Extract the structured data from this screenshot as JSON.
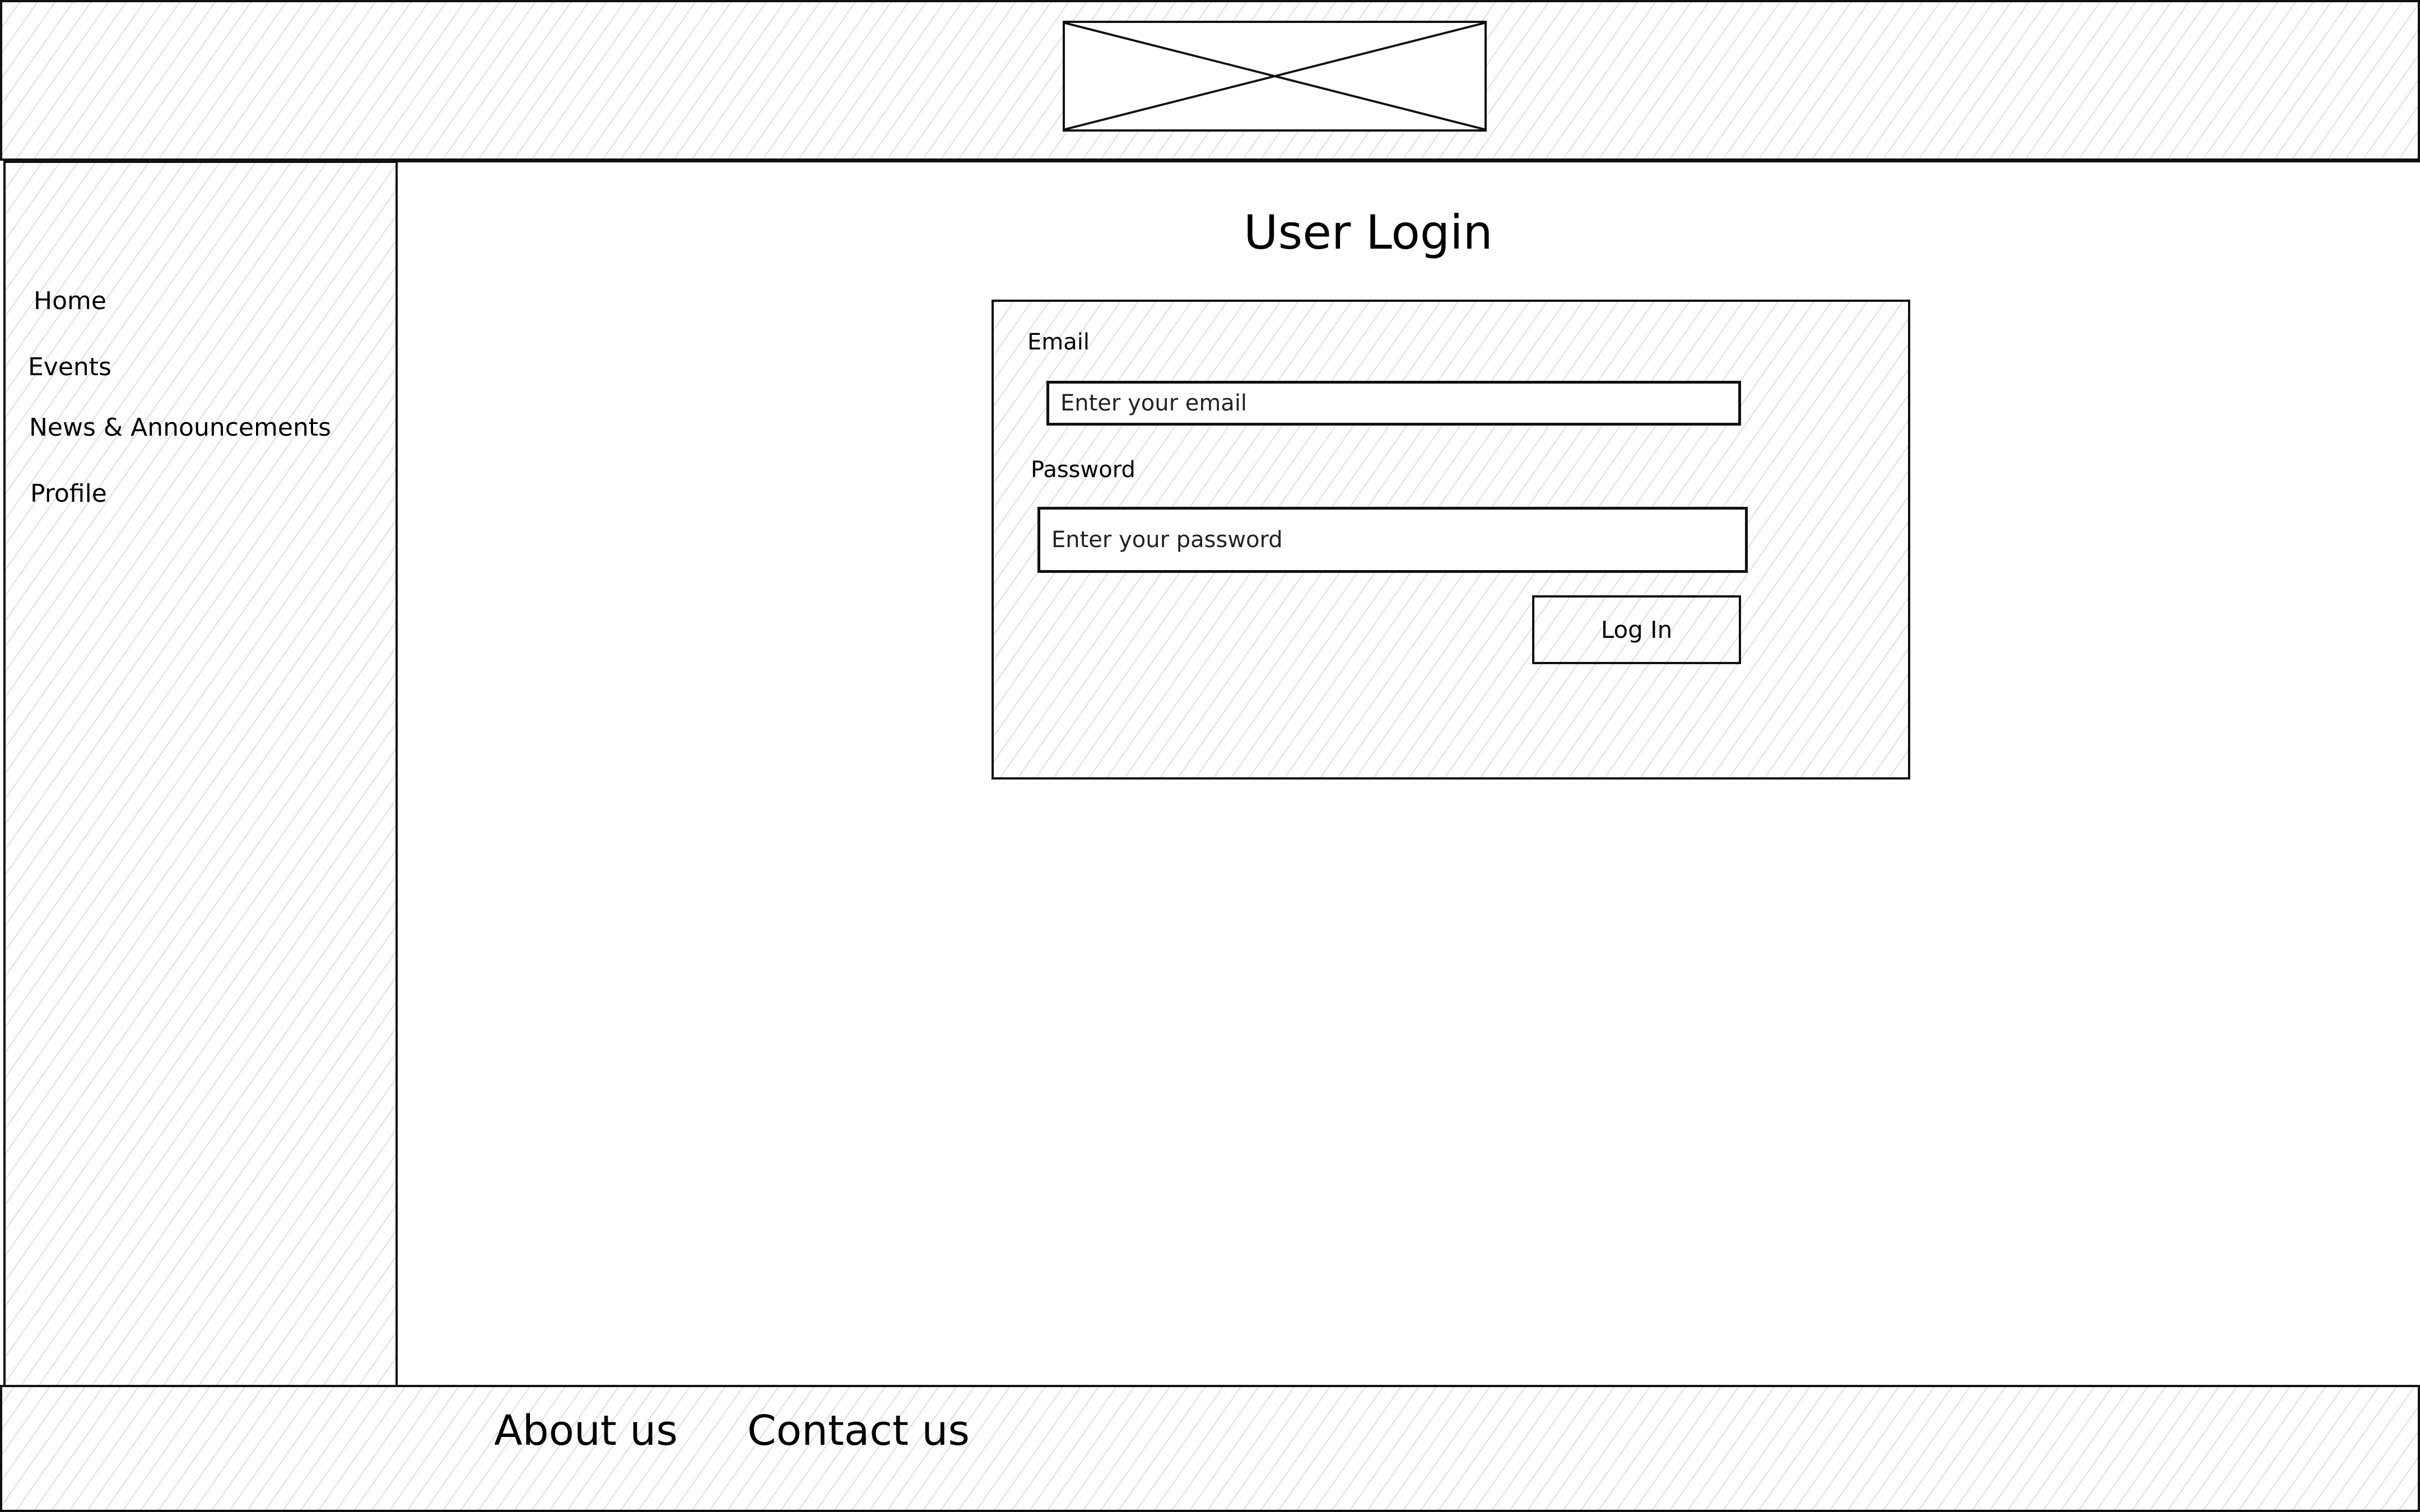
{
  "header": {
    "logo_icon": "image-placeholder-icon"
  },
  "sidebar": {
    "items": [
      {
        "label": "Home"
      },
      {
        "label": "Events"
      },
      {
        "label": "News & Announcements"
      },
      {
        "label": "Profile"
      }
    ]
  },
  "main": {
    "title": "User Login",
    "form": {
      "email_label": "Email",
      "email_placeholder": "Enter your email",
      "email_value": "",
      "password_label": "Password",
      "password_placeholder": "Enter your password",
      "password_value": "",
      "submit_label": "Log In"
    }
  },
  "footer": {
    "links": [
      {
        "label": "About us"
      },
      {
        "label": "Contact us"
      }
    ]
  },
  "colors": {
    "stroke": "#111111",
    "hatch": "#d8d8d8",
    "background": "#ffffff"
  }
}
